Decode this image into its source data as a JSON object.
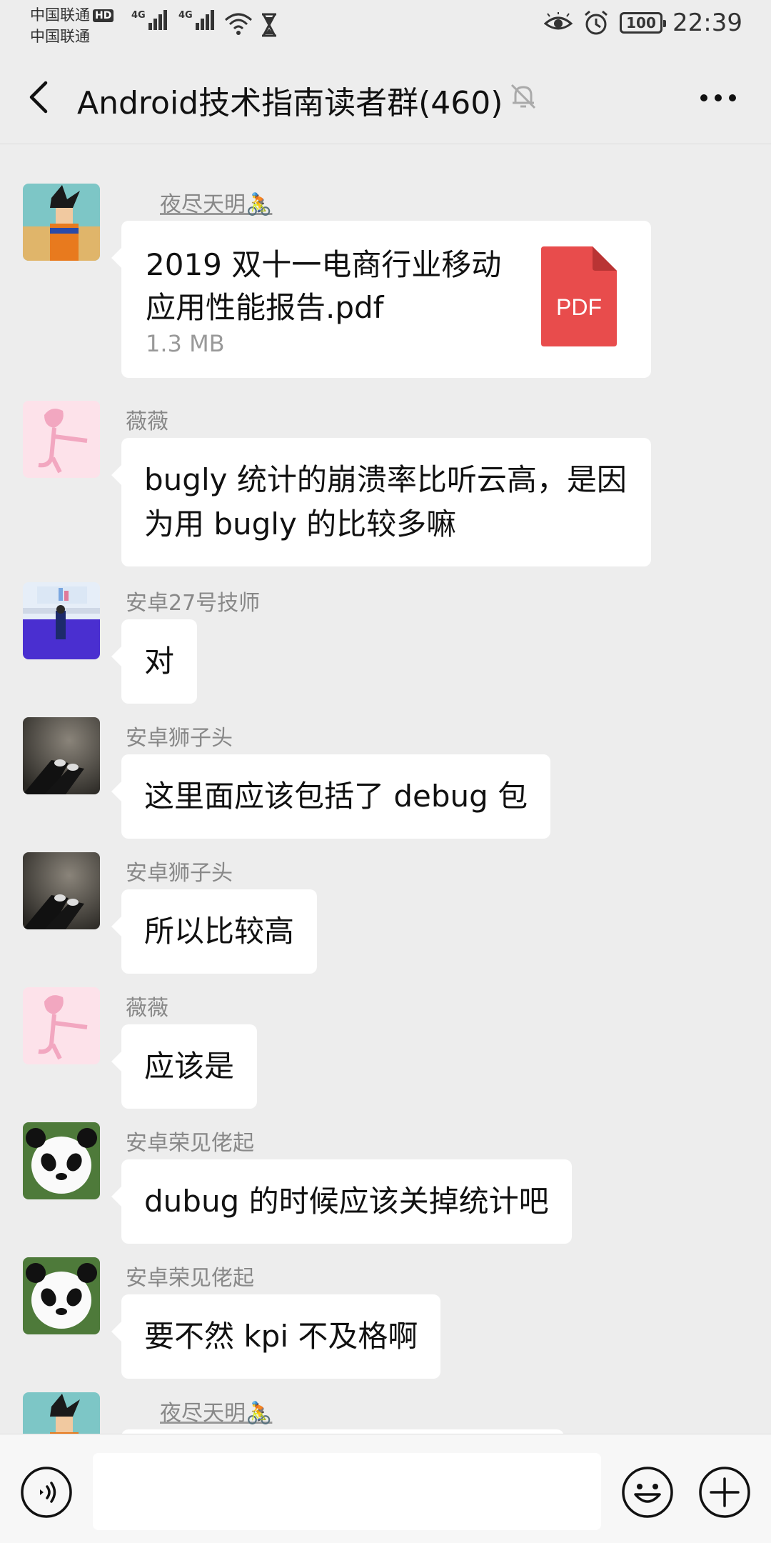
{
  "status_bar": {
    "carrier1": "中国联通",
    "carrier2": "中国联通",
    "hd_badge": "HD",
    "signal_label_1": "4G",
    "signal_label_2": "4G",
    "battery": "100",
    "time": "22:39"
  },
  "header": {
    "title": "Android技术指南读者群(460)"
  },
  "messages": [
    {
      "sender": "夜尽天明🚴",
      "type": "file",
      "file_name": "2019 双十一电商行业移动应用性能报告.pdf",
      "file_size": "1.3 MB",
      "file_badge": "PDF"
    },
    {
      "sender": "薇薇",
      "text": "bugly 统计的崩溃率比听云高，是因为用 bugly 的比较多嘛"
    },
    {
      "sender": "安卓27号技师",
      "text": "对"
    },
    {
      "sender": "安卓狮子头",
      "text": "这里面应该包括了 debug 包"
    },
    {
      "sender": "安卓狮子头",
      "text": "所以比较高"
    },
    {
      "sender": "薇薇",
      "text": "应该是"
    },
    {
      "sender": "安卓荣见佬起",
      "text": "dubug 的时候应该关掉统计吧"
    },
    {
      "sender": "安卓荣见佬起",
      "text": "要不然 kpi 不及格啊"
    },
    {
      "sender": "夜尽天明🚴",
      "text": ""
    }
  ],
  "colors": {
    "background": "#ededed",
    "bubble": "#ffffff",
    "pdf_red": "#e84c4c"
  }
}
